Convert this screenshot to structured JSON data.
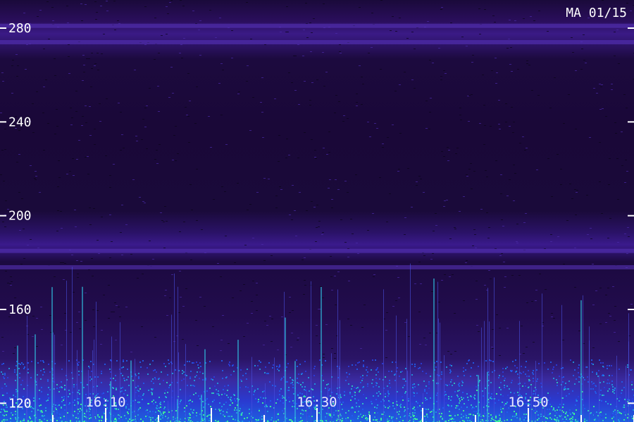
{
  "chart_data": {
    "type": "heatmap",
    "title": "MA 01/15",
    "ylim": [
      112,
      292
    ],
    "y_ticks": [
      120,
      160,
      200,
      240,
      280
    ],
    "y_tick_labels": [
      "120",
      "160",
      "200",
      "240",
      "280"
    ],
    "x_ticks": [
      "16:10",
      "16:30",
      "16:50"
    ],
    "colormap": [
      "#000000",
      "#2a0e5c",
      "#3a1a9c",
      "#2040e0",
      "#20c0d0",
      "#40ff80"
    ],
    "horizontal_bands": [
      281,
      274,
      185,
      178
    ],
    "vertical_streaks_x": [
      "16:10",
      "16:30",
      "16:50"
    ]
  }
}
